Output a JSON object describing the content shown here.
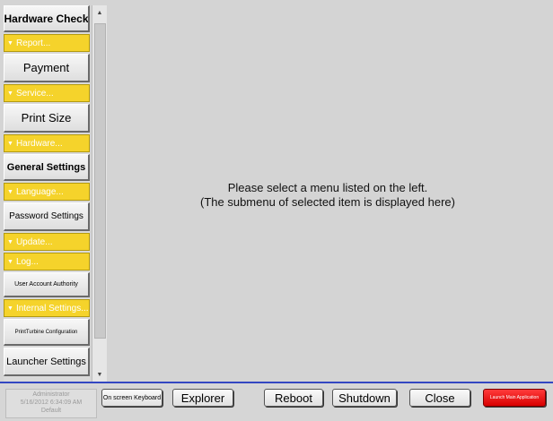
{
  "sidebar": {
    "hardware_check": "Hardware Check",
    "report_cat": "Report...",
    "payment": "Payment",
    "service_cat": "Service...",
    "print_size": "Print Size",
    "hardware_cat": "Hardware...",
    "general_settings": "General Settings",
    "language_cat": "Language...",
    "password_settings": "Password Settings",
    "update_cat": "Update...",
    "log_cat": "Log...",
    "user_account_authority": "User Account Authority",
    "internal_settings_cat": "Internal Settings...",
    "printturbine_configuration": "PrintTurbine Configuration",
    "launcher_settings": "Launcher Settings"
  },
  "main": {
    "message_line1": "Please select a menu listed on the left.",
    "message_line2": "(The submenu of selected item is displayed here)"
  },
  "status": {
    "user": "Administrator",
    "datetime": "5/16/2012 6:34:09 AM",
    "profile": "Default"
  },
  "bottombar": {
    "keyboard": "On screen Keyboard",
    "explorer": "Explorer",
    "reboot": "Reboot",
    "shutdown": "Shutdown",
    "close": "Close",
    "launch": "Launch Main Application"
  },
  "colors": {
    "category_yellow": "#f5d32b",
    "bottom_border_blue": "#3347c2",
    "launch_red": "#e00000"
  }
}
